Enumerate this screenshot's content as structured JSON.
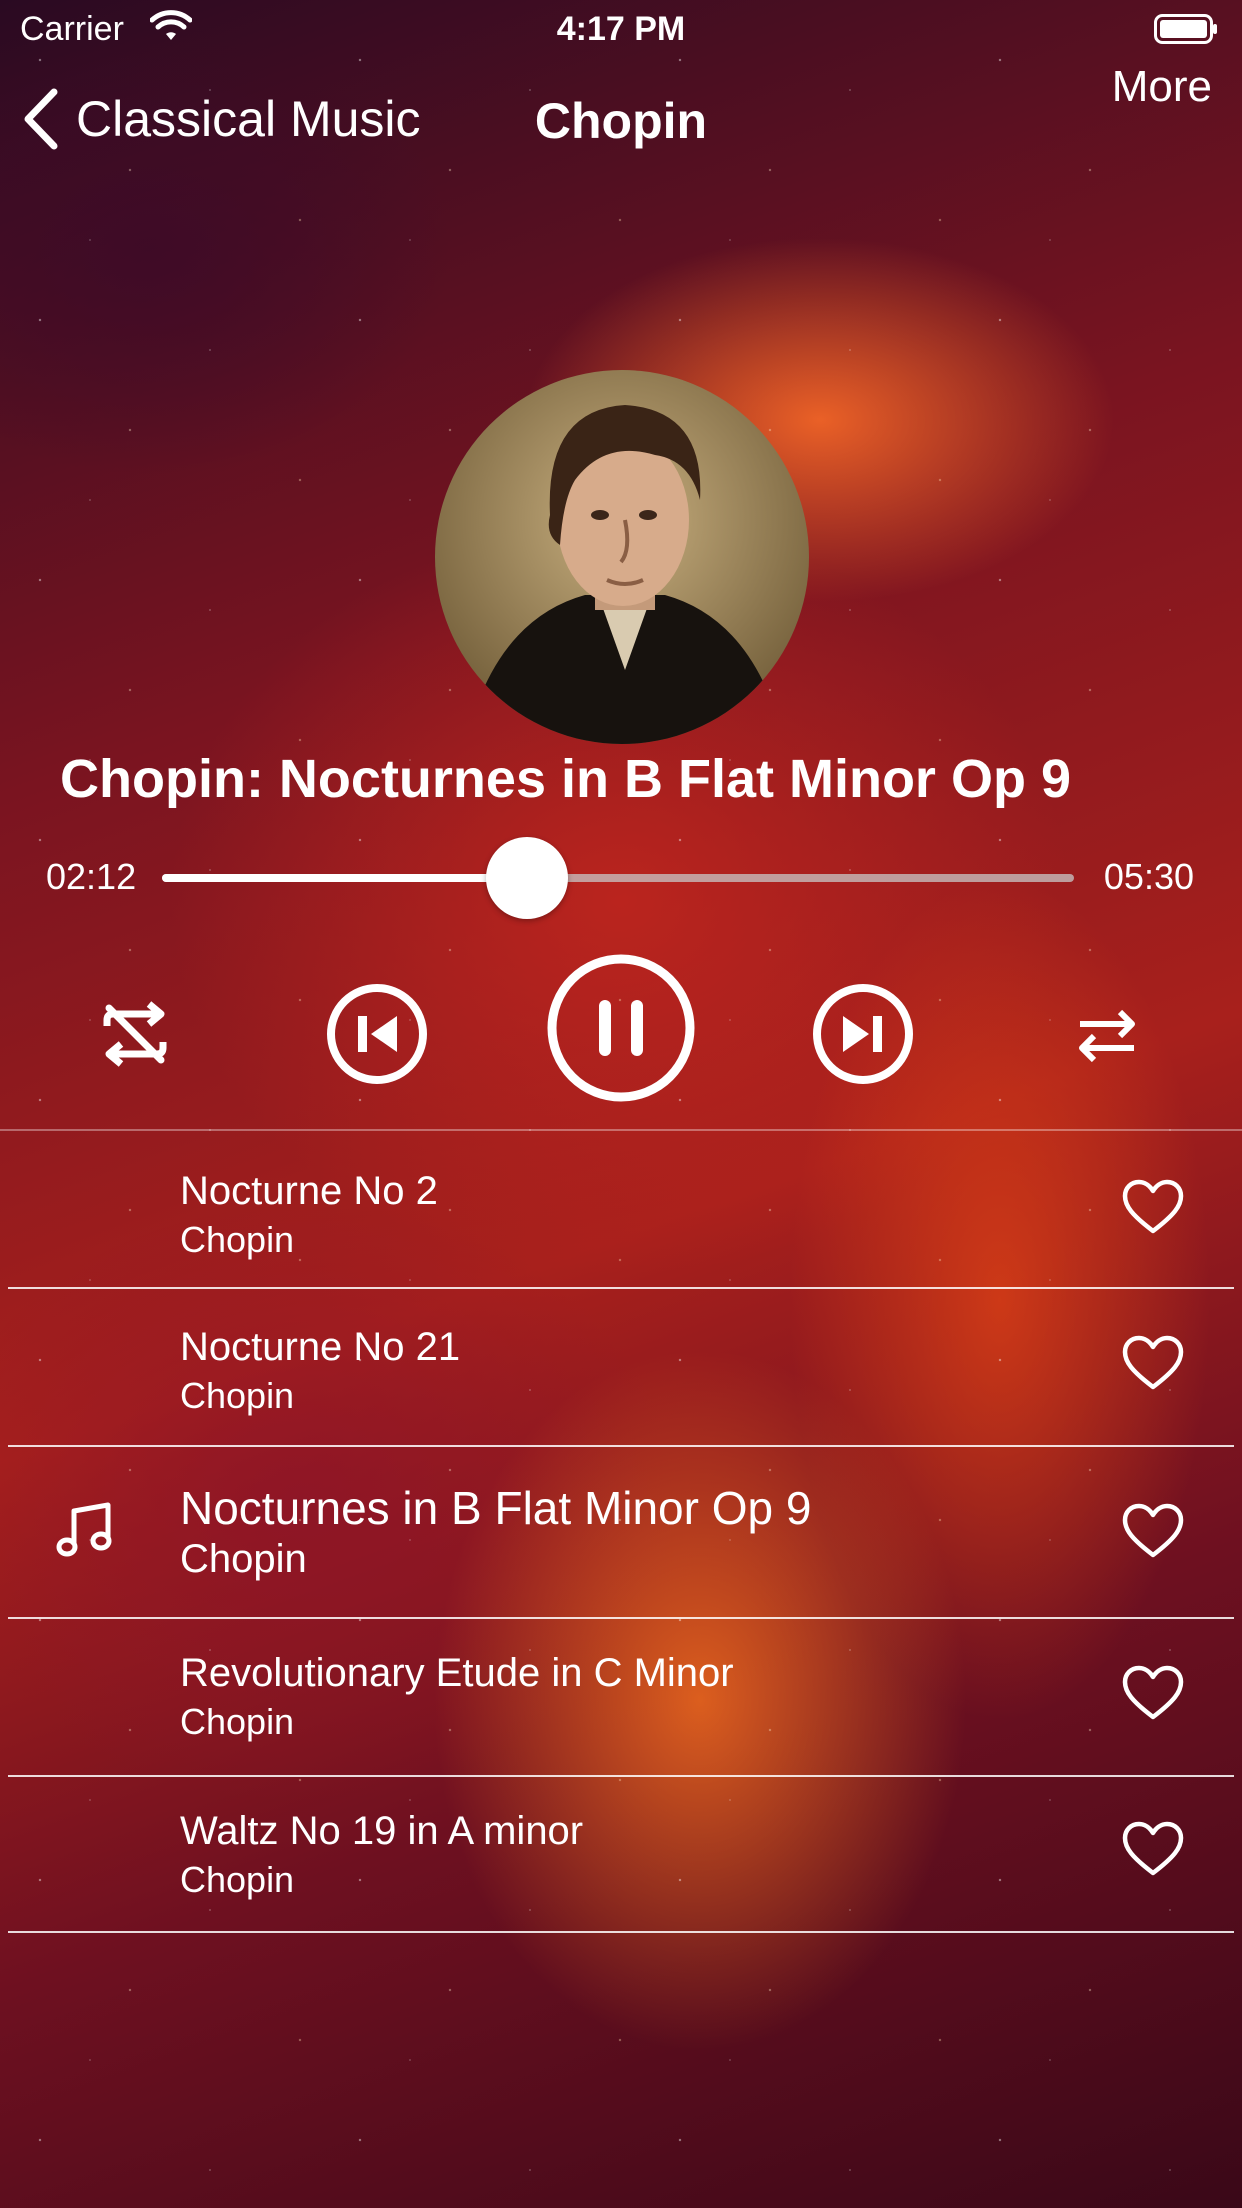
{
  "status_bar": {
    "carrier": "Carrier",
    "time": "4:17 PM"
  },
  "nav": {
    "back_label": "Classical Music",
    "title": "Chopin",
    "more_label": "More"
  },
  "now_playing": {
    "title": "Chopin: Nocturnes in B Flat Minor Op 9",
    "elapsed": "02:12",
    "duration": "05:30",
    "progress": 0.4
  },
  "controls": [
    "repeat-off-icon",
    "previous-icon",
    "pause-icon",
    "next-icon",
    "shuffle-icon"
  ],
  "playlist": [
    {
      "title": "Nocturne No 2",
      "artist": "Chopin",
      "current": false
    },
    {
      "title": "Nocturne No 21",
      "artist": "Chopin",
      "current": false
    },
    {
      "title": "Nocturnes in B Flat Minor Op 9",
      "artist": "Chopin",
      "current": true
    },
    {
      "title": "Revolutionary Etude in C Minor",
      "artist": "Chopin",
      "current": false
    },
    {
      "title": "Waltz No 19 in A minor",
      "artist": "Chopin",
      "current": false
    }
  ]
}
